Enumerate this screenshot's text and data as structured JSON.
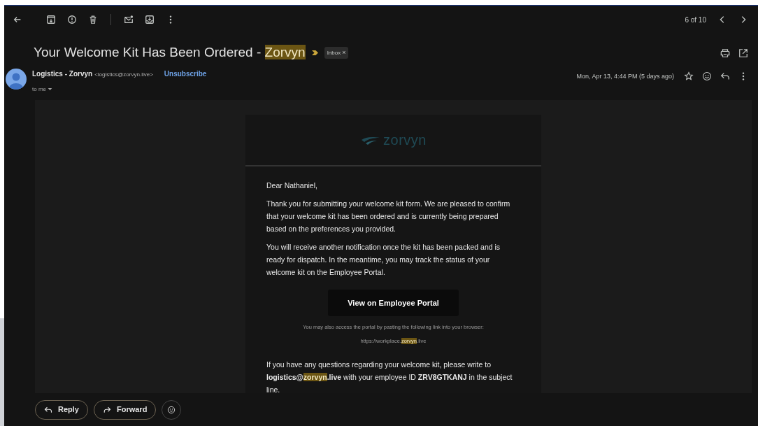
{
  "toolbar": {
    "position": "6 of 10"
  },
  "subject": {
    "segments": [
      {
        "text": "Your Welcome Kit Has Been Ordered - ",
        "highlighted": false
      },
      {
        "text": "Zorvyn",
        "highlighted": true
      }
    ],
    "label": "Inbox",
    "label_remove": "×"
  },
  "sender": {
    "name": "Logistics - Zorvyn",
    "address": "<logistics@zorvyn.live>",
    "unsubscribe": "Unsubscribe",
    "recipient": "to me",
    "date": "Mon, Apr 13, 4:44 PM (5 days ago)",
    "starred": false
  },
  "message": {
    "logo_text": "zorvyn",
    "greeting": "Dear Nathaniel,",
    "paragraphs": [
      "Thank you for submitting your welcome kit form. We are pleased to confirm that your welcome kit has been ordered and is currently being prepared based on the preferences you provided.",
      "You will receive another notification once the kit has been packed and is ready for dispatch. In the meantime, you may track the status of your welcome kit on the Employee Portal."
    ],
    "button": "View on Employee Portal",
    "link_note": "You may also access the portal by pasting the following link into your browser:",
    "link_segments": [
      {
        "text": "https://workplace.",
        "highlighted": false
      },
      {
        "text": "zorvyn",
        "highlighted": true
      },
      {
        "text": ".live",
        "highlighted": false
      }
    ],
    "closing_segments": [
      {
        "text": "If you have any questions regarding your welcome kit, please write to ",
        "bold": false,
        "highlighted": false
      },
      {
        "text": "logistics@",
        "bold": true,
        "highlighted": false
      },
      {
        "text": "zorvyn",
        "bold": true,
        "highlighted": true
      },
      {
        "text": ".live",
        "bold": true,
        "highlighted": false
      },
      {
        "text": " with your employee ID ",
        "bold": false,
        "highlighted": false
      },
      {
        "text": "ZRV8GTKANJ",
        "bold": true,
        "highlighted": false
      },
      {
        "text": " in the subject line.",
        "bold": false,
        "highlighted": false
      }
    ]
  },
  "actions": [
    "Reply",
    "Forward"
  ]
}
